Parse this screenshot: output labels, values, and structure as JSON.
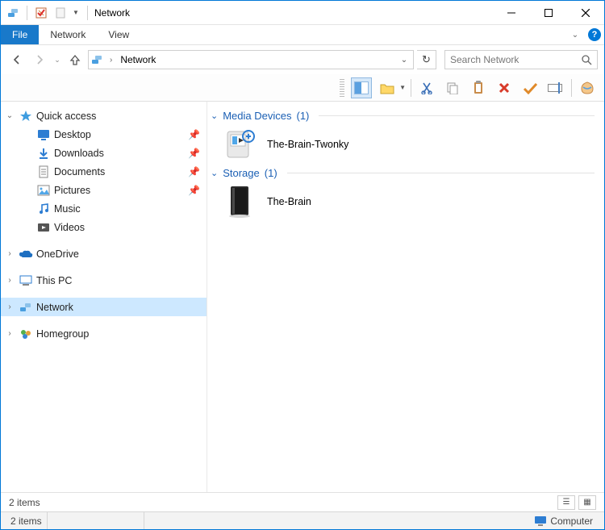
{
  "title": "Network",
  "ribbon": {
    "file": "File",
    "tabs": [
      "Network",
      "View"
    ]
  },
  "address": {
    "crumb": "Network"
  },
  "search": {
    "placeholder": "Search Network"
  },
  "sidebar": {
    "quick": {
      "label": "Quick access",
      "items": [
        {
          "label": "Desktop",
          "pinned": true
        },
        {
          "label": "Downloads",
          "pinned": true
        },
        {
          "label": "Documents",
          "pinned": true
        },
        {
          "label": "Pictures",
          "pinned": true
        },
        {
          "label": "Music",
          "pinned": false
        },
        {
          "label": "Videos",
          "pinned": false
        }
      ]
    },
    "onedrive": {
      "label": "OneDrive"
    },
    "thispc": {
      "label": "This PC"
    },
    "network": {
      "label": "Network"
    },
    "homegroup": {
      "label": "Homegroup"
    }
  },
  "groups": [
    {
      "title": "Media Devices",
      "count": "(1)",
      "items": [
        {
          "name": "The-Brain-Twonky",
          "icon": "media-device"
        }
      ]
    },
    {
      "title": "Storage",
      "count": "(1)",
      "items": [
        {
          "name": "The-Brain",
          "icon": "storage-device"
        }
      ]
    }
  ],
  "status": {
    "line1": "2 items",
    "line2_left": "2 items",
    "line2_right": "Computer"
  }
}
